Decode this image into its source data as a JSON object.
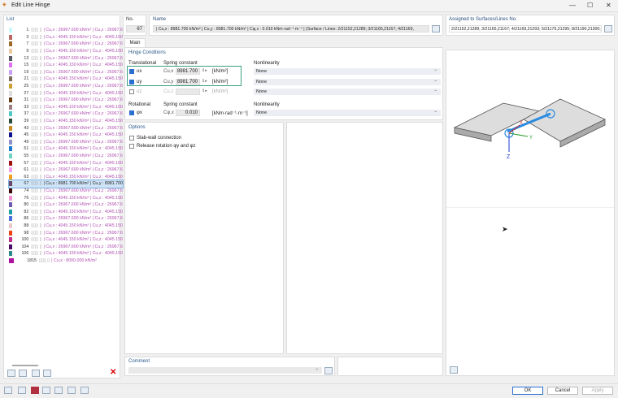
{
  "window": {
    "title": "Edit Line Hinge"
  },
  "list": {
    "title": "List",
    "rows": [
      {
        "no": "1",
        "color": "#c8f8f8",
        "text": "| Cu,x : 26967.600 kN/m² | Cu,z : 26967.6"
      },
      {
        "no": "3",
        "color": "#b86a66",
        "text": "| Cu,x : 4045.150 kN/m² | Cu,z : 4045.150"
      },
      {
        "no": "7",
        "color": "#9a6a2a",
        "text": "| Cu,x : 26967.600 kN/m² | Cu,z : 26967.6"
      },
      {
        "no": "9",
        "color": "#eec8a0",
        "text": "| Cu,x : 4045.150 kN/m² | Cu,z : 4045.150"
      },
      {
        "no": "13",
        "color": "#5a5a66",
        "text": "| Cu,x : 26967.600 kN/m² | Cu,z : 26967.6"
      },
      {
        "no": "15",
        "color": "#e070f0",
        "text": "| Cu,x : 4045.150 kN/m² | Cu,z : 4045.150"
      },
      {
        "no": "19",
        "color": "#c8a0f8",
        "text": "| Cu,x : 26967.600 kN/m² | Cu,z : 26967.6"
      },
      {
        "no": "21",
        "color": "#7a6a5a",
        "text": "| Cu,x : 4045.150 kN/m² | Cu,z : 4045.150"
      },
      {
        "no": "25",
        "color": "#c8a030",
        "text": "| Cu,x : 26967.600 kN/m² | Cu,z : 26967.6"
      },
      {
        "no": "27",
        "color": "#dcdcdc",
        "text": "| Cu,x : 4045.150 kN/m² | Cu,z : 4045.150"
      },
      {
        "no": "31",
        "color": "#6a3a10",
        "text": "| Cu,x : 26967.600 kN/m² | Cu,z : 26967.6"
      },
      {
        "no": "33",
        "color": "#9a8080",
        "text": "| Cu,x : 4045.150 kN/m² | Cu,z : 4045.150"
      },
      {
        "no": "37",
        "color": "#50c8c8",
        "text": "| Cu,x : 26967.600 kN/m² | Cu,z : 26967.6"
      },
      {
        "no": "39",
        "color": "#2a4a3a",
        "text": "| Cu,x : 4045.150 kN/m² | Cu,z : 4045.150"
      },
      {
        "no": "43",
        "color": "#c88a20",
        "text": "| Cu,x : 26967.600 kN/m² | Cu,z : 26967.6"
      },
      {
        "no": "45",
        "color": "#10108a",
        "text": "| Cu,x : 4045.150 kN/m² | Cu,z : 4045.150"
      },
      {
        "no": "49",
        "color": "#9090c8",
        "text": "| Cu,x : 26967.600 kN/m² | Cu,z : 26967.6"
      },
      {
        "no": "51",
        "color": "#1a7ad0",
        "text": "| Cu,x : 4045.150 kN/m² | Cu,z : 4045.150"
      },
      {
        "no": "55",
        "color": "#70d0c0",
        "text": "| Cu,x : 26967.600 kN/m² | Cu,z : 26967.6"
      },
      {
        "no": "57",
        "color": "#a01010",
        "text": "| Cu,x : 4045.150 kN/m² | Cu,z : 4045.150"
      },
      {
        "no": "61",
        "color": "#f0a0f0",
        "text": "| Cu,x : 26967.600 kN/m² | Cu,z : 26967.6"
      },
      {
        "no": "63",
        "color": "#f0a020",
        "text": "| Cu,x : 4045.150 kN/m² | Cu,z : 4045.150"
      },
      {
        "no": "67",
        "color": "#6a4a6a",
        "text": "| Cu,x : 8981.700 kN/m² | Cu,y : 8981.700"
      },
      {
        "no": "74",
        "color": "#3a0a0a",
        "text": "| Cu,x : 26967.600 kN/m² | Cu,z : 26967.6"
      },
      {
        "no": "76",
        "color": "#f090d0",
        "text": "| Cu,x : 4045.150 kN/m² | Cu,z : 4045.150"
      },
      {
        "no": "80",
        "color": "#6a5ab0",
        "text": "| Cu,x : 26967.600 kN/m² | Cu,z : 26967.6"
      },
      {
        "no": "82",
        "color": "#20a0a0",
        "text": "| Cu,x : 4045.150 kN/m² | Cu,z : 4045.150"
      },
      {
        "no": "86",
        "color": "#4a70e0",
        "text": "| Cu,x : 26967.600 kN/m² | Cu,z : 26967.6"
      },
      {
        "no": "88",
        "color": "#e8c8c8",
        "text": "| Cu,x : 4045.150 kN/m² | Cu,z : 4045.150"
      },
      {
        "no": "98",
        "color": "#f04010",
        "text": "| Cu,x : 26967.600 kN/m² | Cu,z : 26967.6"
      },
      {
        "no": "100",
        "color": "#c0308a",
        "text": "| Cu,x : 4045.150 kN/m² | Cu,z : 4045.150"
      },
      {
        "no": "104",
        "color": "#4a0a6a",
        "text": "| Cu,x : 26967.600 kN/m² | Cu,z : 26967.6"
      },
      {
        "no": "106",
        "color": "#2a8a8a",
        "text": "| Cu,x : 4045.150 kN/m² | Cu,z : 4045.150"
      },
      {
        "no": "1815",
        "color": "#b010a0",
        "text": "| Cu,x : 8000.000 kN/m²"
      }
    ]
  },
  "header": {
    "no_label": "No.",
    "no_value": "67",
    "name_label": "Name",
    "name_value": "| Cu,x : 8981.700 kN/m² | Cu,y : 8981.700 kN/m² | Cφ,x : 0.010 kNm·rad⁻¹·m⁻¹ | (Surface / Lines: 2/21152,21289; 3/21165,21167; 4/21169,",
    "assigned_label": "Assigned to Surfaces/Lines No.",
    "assigned_value": "2/21152,21289; 3/21165,21167; 4/21169,21293; 5/21176,21295; 8/21190,21300;"
  },
  "tabs": [
    "Main"
  ],
  "hinge": {
    "title": "Hinge Conditions",
    "translational": "Translational",
    "rotational": "Rotational",
    "spring_constant": "Spring constant",
    "nonlinearity": "Nonlinearity",
    "rows": [
      {
        "label": "ux",
        "sym": "Cu,x",
        "value": "8981.700",
        "unit": "[kN/m²]",
        "nl": "None",
        "checked": true
      },
      {
        "label": "uy",
        "sym": "Cu,y",
        "value": "8981.700",
        "unit": "[kN/m²]",
        "nl": "None",
        "checked": true
      },
      {
        "label": "uz",
        "sym": "Cu,z",
        "value": "",
        "unit": "[kN/m²]",
        "nl": "None",
        "checked": false
      }
    ],
    "rot": {
      "label": "φx",
      "sym": "Cφ,x",
      "value": "0.010",
      "unit": "[kNm·rad⁻¹·m⁻¹]",
      "nl": "None",
      "checked": true
    }
  },
  "options": {
    "title": "Options",
    "items": [
      "Slab-wall connection",
      "Release rotation φy and φz"
    ]
  },
  "comment": {
    "label": "Comment"
  },
  "buttons": {
    "ok": "OK",
    "cancel": "Cancel",
    "apply": "Apply"
  },
  "view": {
    "axis_x": "X",
    "axis_y": "Y",
    "axis_z": "Z"
  }
}
